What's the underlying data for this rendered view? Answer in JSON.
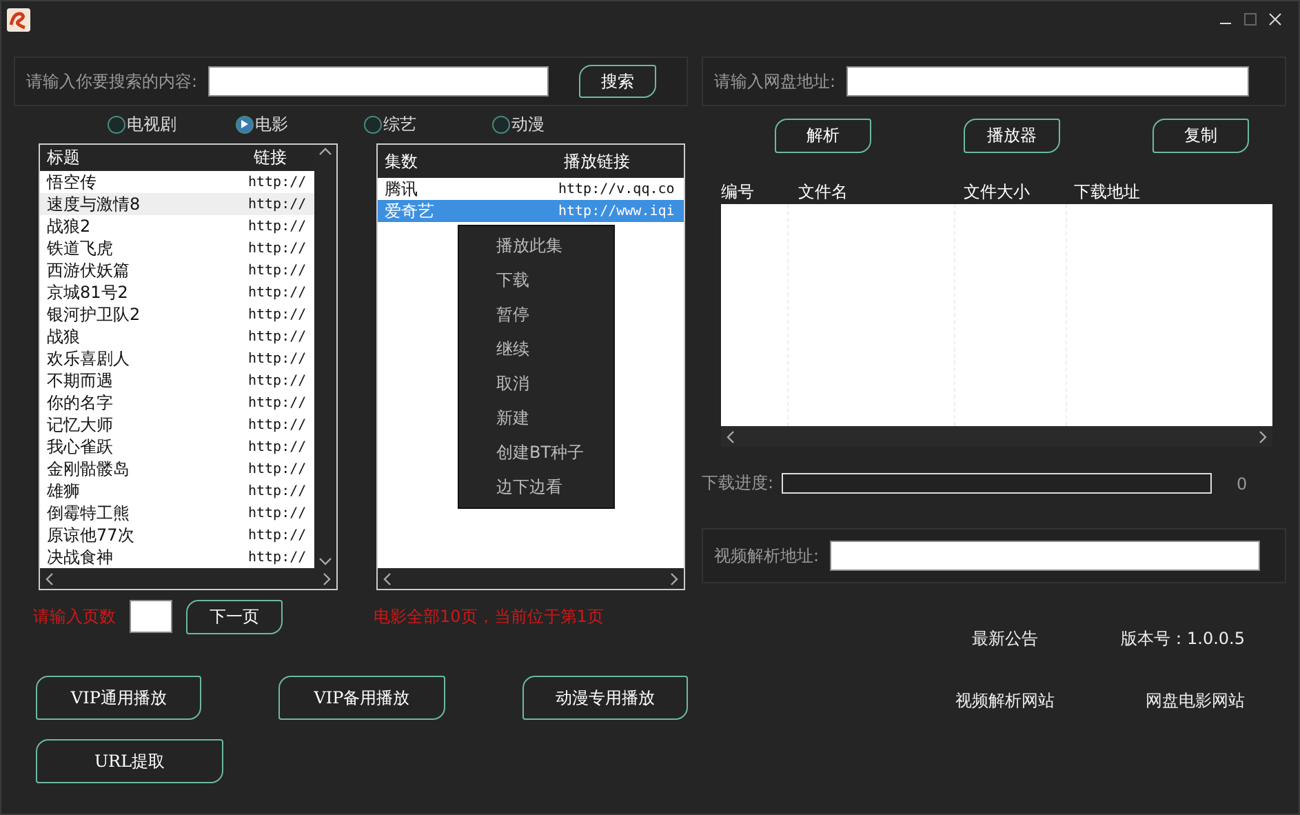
{
  "search": {
    "label": "请输入你要搜索的内容:",
    "button": "搜索"
  },
  "categories": [
    {
      "label": "电视剧",
      "selected": false
    },
    {
      "label": "电影",
      "selected": true
    },
    {
      "label": "综艺",
      "selected": false
    },
    {
      "label": "动漫",
      "selected": false
    }
  ],
  "title_list": {
    "columns": [
      "标题",
      "链接"
    ],
    "rows": [
      {
        "title": "悟空传",
        "link": "http://",
        "selected": false
      },
      {
        "title": "速度与激情8",
        "link": "http://",
        "selected": true
      },
      {
        "title": "战狼2",
        "link": "http://",
        "selected": false
      },
      {
        "title": "铁道飞虎",
        "link": "http://",
        "selected": false
      },
      {
        "title": "西游伏妖篇",
        "link": "http://",
        "selected": false
      },
      {
        "title": "京城81号2",
        "link": "http://",
        "selected": false
      },
      {
        "title": "银河护卫队2",
        "link": "http://",
        "selected": false
      },
      {
        "title": "战狼",
        "link": "http://",
        "selected": false
      },
      {
        "title": "欢乐喜剧人",
        "link": "http://",
        "selected": false
      },
      {
        "title": "不期而遇",
        "link": "http://",
        "selected": false
      },
      {
        "title": "你的名字",
        "link": "http://",
        "selected": false
      },
      {
        "title": "记忆大师",
        "link": "http://",
        "selected": false
      },
      {
        "title": "我心雀跃",
        "link": "http://",
        "selected": false
      },
      {
        "title": "金刚骷髅岛",
        "link": "http://",
        "selected": false
      },
      {
        "title": "雄狮",
        "link": "http://",
        "selected": false
      },
      {
        "title": "倒霉特工熊",
        "link": "http://",
        "selected": false
      },
      {
        "title": "原谅他77次",
        "link": "http://",
        "selected": false
      },
      {
        "title": "决战食神",
        "link": "http://",
        "selected": false
      }
    ]
  },
  "episode_list": {
    "columns": [
      "集数",
      "播放链接"
    ],
    "rows": [
      {
        "title": "腾讯",
        "link": "http://v.qq.co",
        "selected": false
      },
      {
        "title": "爱奇艺",
        "link": "http://www.iqi",
        "selected": true
      }
    ]
  },
  "context_menu": [
    "播放此集",
    "下载",
    "暂停",
    "继续",
    "取消",
    "新建",
    "创建BT种子",
    "边下边看"
  ],
  "paging": {
    "label": "请输入页数",
    "button": "下一页",
    "status": "电影全部10页，当前位于第1页"
  },
  "play_buttons": [
    "VIP通用播放",
    "VIP备用播放",
    "动漫专用播放",
    "URL提取"
  ],
  "netdisk": {
    "label": "请输入网盘地址:",
    "buttons": [
      "解析",
      "播放器",
      "复制"
    ]
  },
  "files": {
    "columns": [
      "编号",
      "文件名",
      "文件大小",
      "下载地址"
    ]
  },
  "progress": {
    "label": "下载进度:",
    "level": 0,
    "reading": "0"
  },
  "video_parse": {
    "label": "视频解析地址:"
  },
  "footer": {
    "notice": "最新公告",
    "version": "版本号：1.0.0.5",
    "links": [
      "视频解析网站",
      "网盘电影网站"
    ]
  }
}
